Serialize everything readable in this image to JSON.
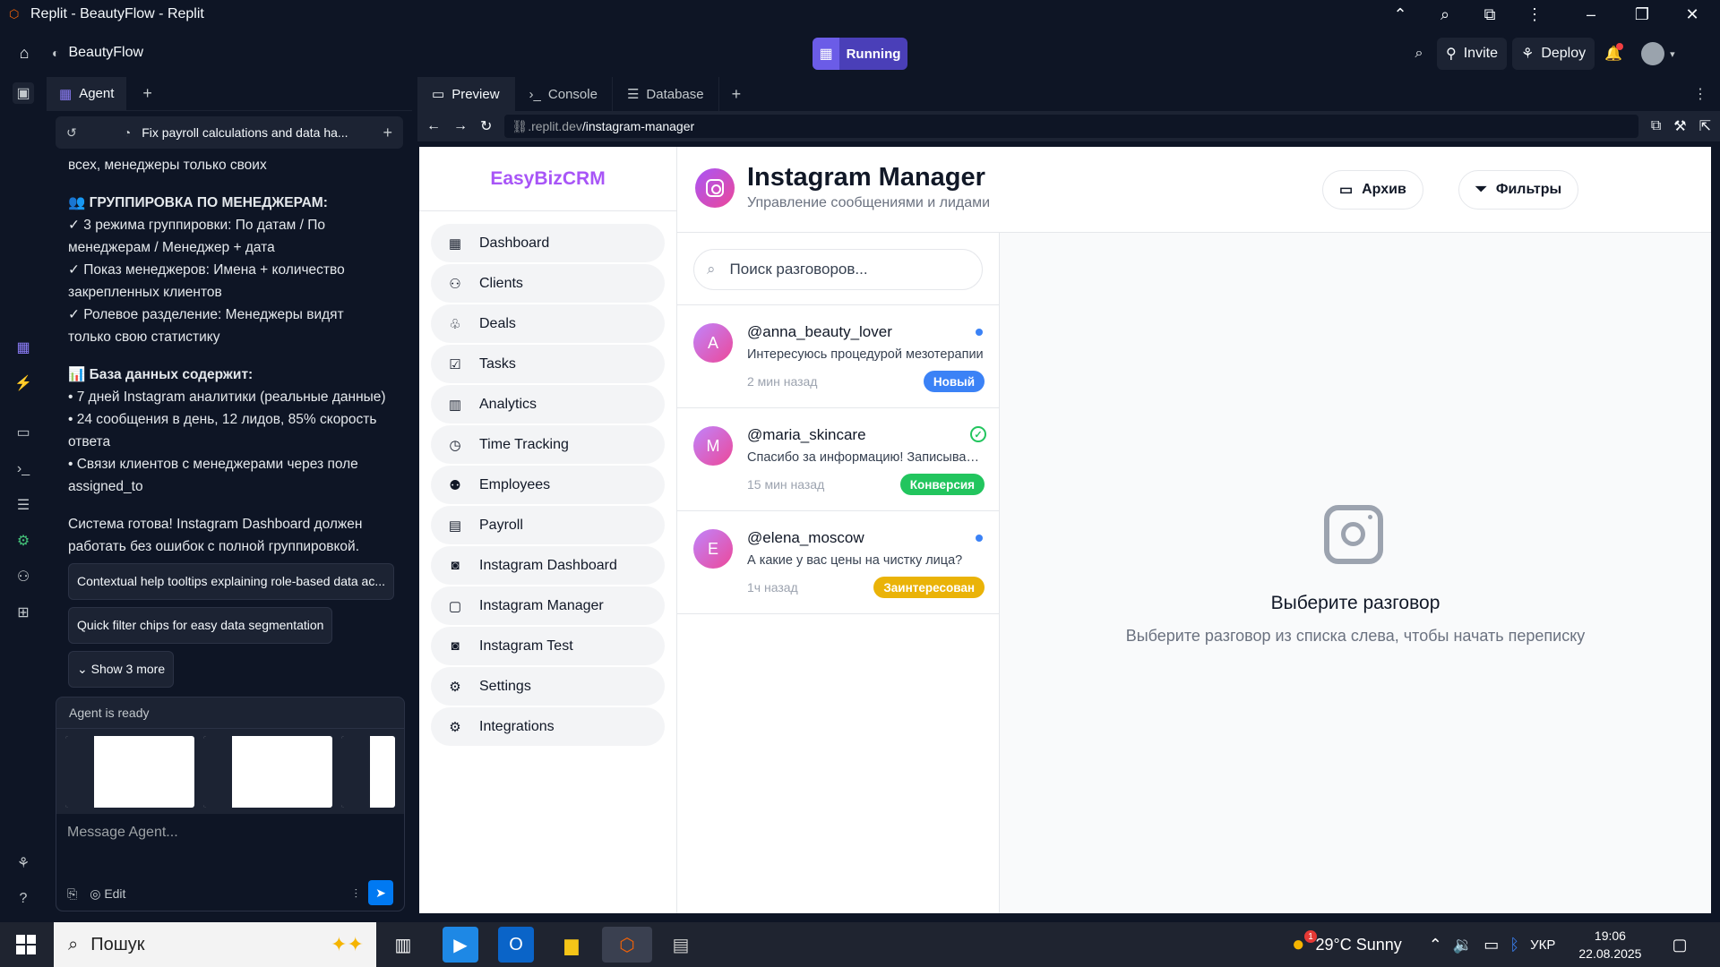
{
  "window": {
    "title": "Replit - BeautyFlow - Replit"
  },
  "topbar": {
    "project": "BeautyFlow",
    "run_label": "Running",
    "invite": "Invite",
    "deploy": "Deploy"
  },
  "agent": {
    "tab": "Agent",
    "session": "Fix payroll calculations and data ha...",
    "lines": [
      "всех, менеджеры только своих",
      "",
      "👥 ГРУППИРОВКА ПО МЕНЕДЖЕРАМ:",
      "✓ 3 режима группировки: По датам / По",
      "менеджерам / Менеджер + дата",
      "✓ Показ менеджеров: Имена + количество",
      "закрепленных клиентов",
      "✓ Ролевое разделение: Менеджеры видят",
      "только свою статистику",
      "",
      "📊 База данных содержит:",
      "• 7 дней Instagram аналитики (реальные данные)",
      "• 24 сообщения в день, 12 лидов, 85% скорость",
      "ответа",
      "• Связи клиентов с менеджерами через поле",
      "assigned_to",
      "",
      "Система готова! Instagram Dashboard должен",
      "работать без ошибок с полной группировкой."
    ],
    "chips": [
      "Contextual help tooltips explaining role-based data ac...",
      "Quick filter chips for easy data segmentation"
    ],
    "show_more": "Show 3 more",
    "status": "Agent is ready",
    "message_placeholder": "Message Agent...",
    "edit": "Edit"
  },
  "preview": {
    "tabs": [
      "Preview",
      "Console",
      "Database"
    ],
    "url_prefix": ".replit.dev",
    "url_path": "/instagram-manager"
  },
  "app": {
    "logo": "EasyBizCRM",
    "nav": [
      "Dashboard",
      "Clients",
      "Deals",
      "Tasks",
      "Analytics",
      "Time Tracking",
      "Employees",
      "Payroll",
      "Instagram Dashboard",
      "Instagram Manager",
      "Instagram Test",
      "Settings",
      "Integrations"
    ],
    "title": "Instagram Manager",
    "subtitle": "Управление сообщениями и лидами",
    "archive": "Архив",
    "filters": "Фильтры",
    "search_placeholder": "Поиск разговоров...",
    "conversations": [
      {
        "initial": "A",
        "name": "@anna_beauty_lover",
        "message": "Интересуюсь процедурой мезотерапии",
        "time": "2 мин назад",
        "badge": "Новый",
        "badge_color": "#3b82f6",
        "indicator": "dot"
      },
      {
        "initial": "M",
        "name": "@maria_skincare",
        "message": "Спасибо за информацию! Записываюсь на процедуру",
        "time": "15 мин назад",
        "badge": "Конверсия",
        "badge_color": "#22c55e",
        "indicator": "check"
      },
      {
        "initial": "E",
        "name": "@elena_moscow",
        "message": "А какие у вас цены на чистку лица?",
        "time": "1ч назад",
        "badge": "Заинтересован",
        "badge_color": "#eab308",
        "indicator": "dot"
      }
    ],
    "empty_title": "Выберите разговор",
    "empty_text": "Выберите разговор из списка слева, чтобы начать переписку"
  },
  "taskbar": {
    "search": "Пошук",
    "weather": "29°C  Sunny",
    "weather_badge": "1",
    "lang": "УКР",
    "time": "19:06",
    "date": "22.08.2025"
  }
}
